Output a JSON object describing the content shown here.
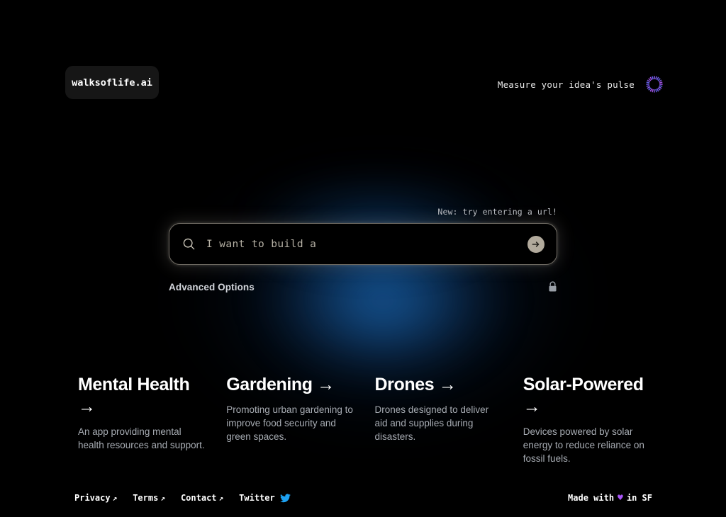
{
  "header": {
    "logo": "walksoflife.ai",
    "tagline": "Measure your idea's pulse",
    "pulse_icon": "pulse-burst-icon"
  },
  "hero": {
    "new_hint": "New: try entering a url!",
    "search": {
      "icon": "search-icon",
      "placeholder": "I want to build a",
      "value": "",
      "submit_icon": "arrow-right-circle-icon"
    },
    "advanced_options_label": "Advanced Options",
    "lock_icon": "lock-icon"
  },
  "cards": [
    {
      "title": "Mental Health",
      "arrow": "→",
      "description": "An app providing mental health resources and support."
    },
    {
      "title": "Gardening",
      "arrow": "→",
      "description": "Promoting urban gardening to improve food security and green spaces."
    },
    {
      "title": "Drones",
      "arrow": "→",
      "description": "Drones designed to deliver aid and supplies during disasters."
    },
    {
      "title": "Solar-Powered",
      "arrow": "→",
      "description": "Devices powered by solar energy to reduce reliance on fossil fuels."
    }
  ],
  "footer": {
    "links": [
      {
        "label": "Privacy",
        "ext": "↗"
      },
      {
        "label": "Terms",
        "ext": "↗"
      },
      {
        "label": "Contact",
        "ext": "↗"
      },
      {
        "label": "Twitter",
        "ext": ""
      }
    ],
    "twitter_icon": "twitter-bird-icon",
    "made_with_prefix": "Made with",
    "heart": "♥",
    "made_with_suffix": "in SF"
  },
  "colors": {
    "background": "#000000",
    "glow_blue": "#134e8c",
    "accent_beige": "#b2aa9c",
    "twitter_blue": "#1da1f2",
    "heart_purple": "#a855f7",
    "pulse_purple": "#8b5cf6"
  }
}
